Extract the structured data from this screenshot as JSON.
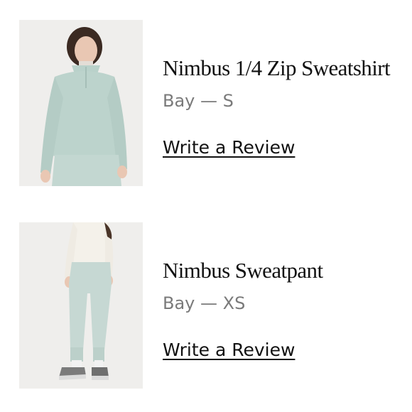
{
  "items": [
    {
      "title": "Nimbus 1/4 Zip Sweatshirt",
      "variant": "Bay — S",
      "review_label": "Write a Review",
      "image_icon": "model-wearing-sweatshirt-photo",
      "garment_color": "#bcd3cc"
    },
    {
      "title": "Nimbus Sweatpant",
      "variant": "Bay — XS",
      "review_label": "Write a Review",
      "image_icon": "model-wearing-sweatpant-photo",
      "garment_color": "#c6d8d3"
    }
  ]
}
